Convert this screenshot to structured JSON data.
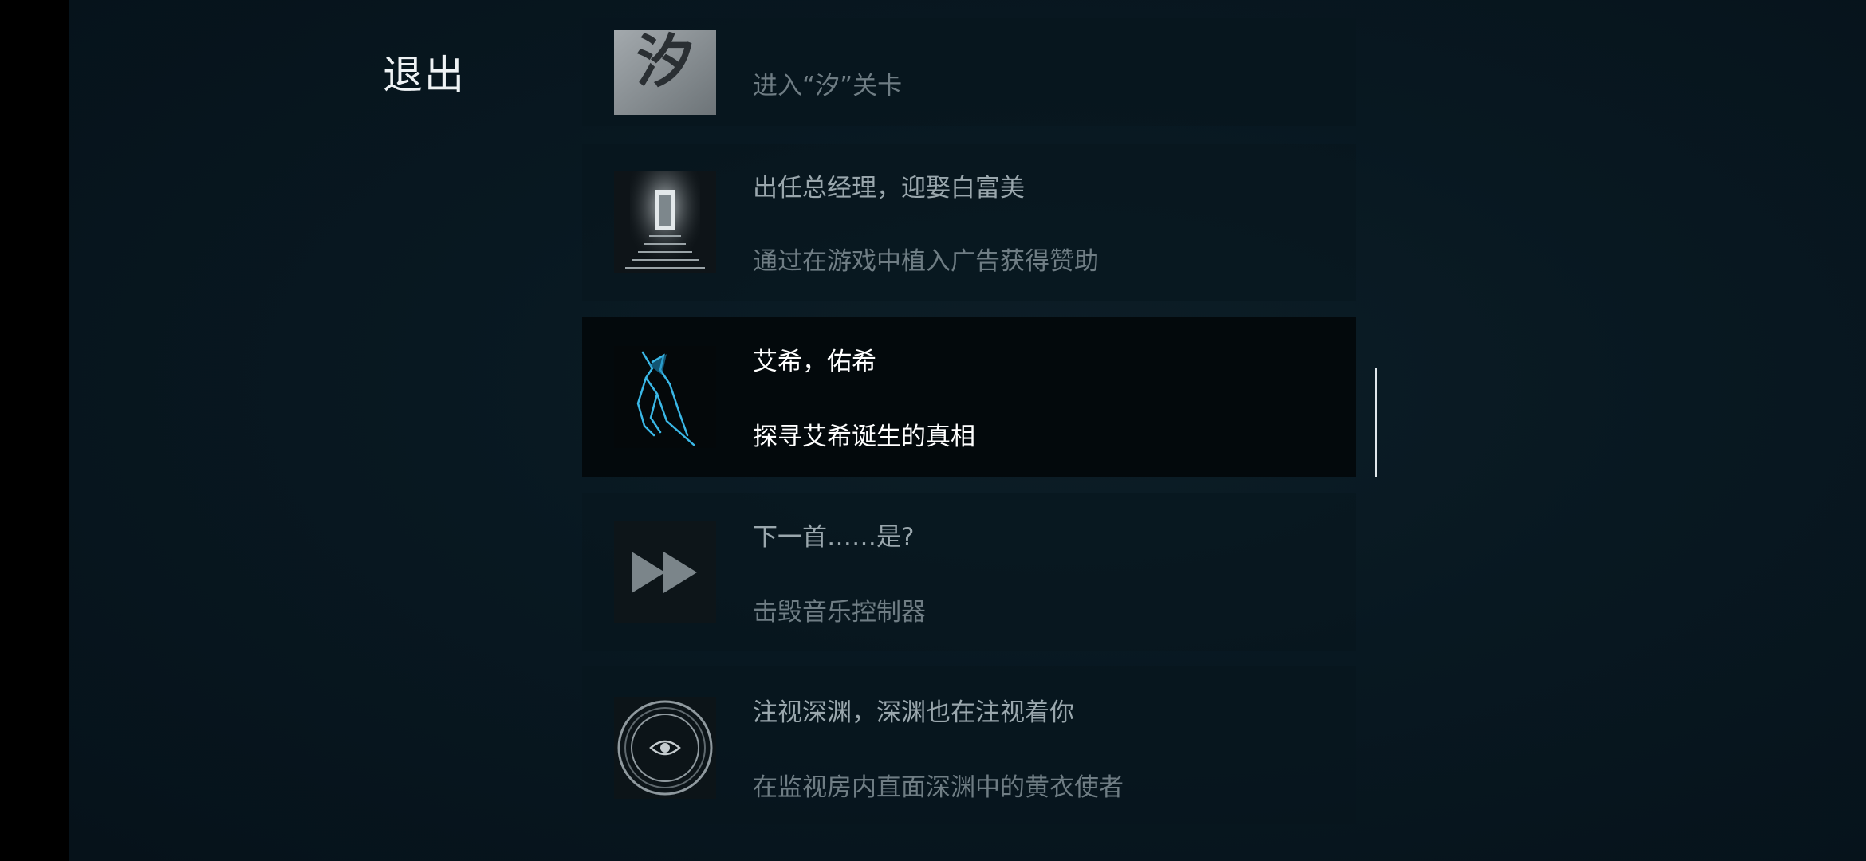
{
  "menu": {
    "exit_label": "退出"
  },
  "achievements": [
    {
      "thumb_text": "汐",
      "title": "",
      "description": "进入“汐”关卡",
      "icon": "xi-character-icon"
    },
    {
      "title": "出任总经理，迎娶白富美",
      "description": "通过在游戏中植入广告获得赞助",
      "icon": "corridor-stairs-icon"
    },
    {
      "title": "艾希，佑希",
      "description": "探寻艾希诞生的真相",
      "icon": "blue-sword-figure-icon",
      "selected": true
    },
    {
      "title": "下一首……是?",
      "description": "击毁音乐控制器",
      "icon": "fast-forward-icon"
    },
    {
      "title": "注视深渊，深渊也在注视着你",
      "description": "在监视房内直面深渊中的黄衣使者",
      "icon": "eye-circle-icon"
    }
  ],
  "colors": {
    "background": "#081821",
    "card": "#0b1a22",
    "selected_card": "#03090c",
    "highlight_text": "#ffffff",
    "muted_text": "#9aa7ad"
  }
}
